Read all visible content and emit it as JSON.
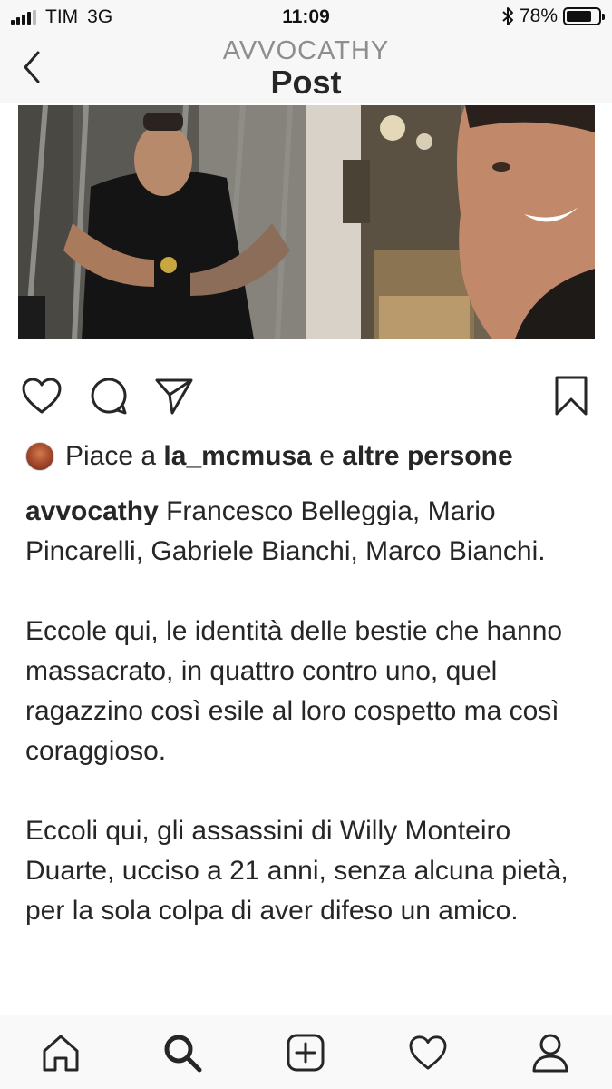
{
  "status_bar": {
    "carrier": "TIM",
    "network": "3G",
    "time": "11:09",
    "battery_text": "78%",
    "battery_level": 0.78
  },
  "header": {
    "username": "AVVOCATHY",
    "title": "Post"
  },
  "icons": {
    "back": "chevron-left-icon",
    "like": "heart-icon",
    "comment": "comment-bubble-icon",
    "share": "paper-plane-icon",
    "save": "bookmark-icon",
    "home": "home-icon",
    "search": "search-icon",
    "new_post": "add-square-icon",
    "activity": "heart-icon",
    "profile": "person-icon"
  },
  "likes": {
    "prefix": "Piace a",
    "user": "la_mcmusa",
    "conjunction": "e",
    "others": "altre persone"
  },
  "caption": {
    "author": "avvocathy",
    "paragraph1": "Francesco Belleggia, Mario Pincarelli, Gabriele Bianchi, Marco Bianchi.",
    "paragraph2": "Eccole qui, le identità delle bestie che hanno massacrato, in quattro contro uno, quel ragazzino così esile al loro cospetto ma così coraggioso.",
    "paragraph3": "Eccoli qui, gli assassini di Willy Monteiro Duarte, ucciso a 21 anni, senza alcuna pietà, per la sola colpa di aver difeso un amico."
  }
}
